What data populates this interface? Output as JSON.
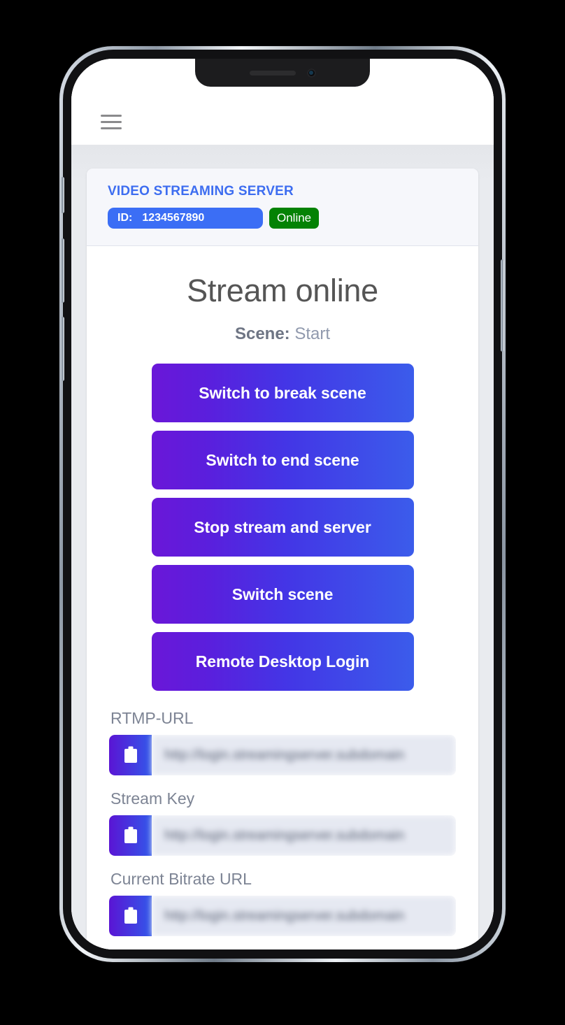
{
  "device": {
    "type": "smartphone-mockup",
    "notch": {
      "speaker": "earpiece-speaker",
      "camera": "front-camera"
    },
    "buttons": [
      "mute-switch",
      "volume-up",
      "volume-down",
      "power"
    ]
  },
  "app": {
    "topbar": {
      "menu_icon": "hamburger-menu-icon"
    },
    "card": {
      "server_title": "VIDEO STREAMING SERVER",
      "id_label": "ID:",
      "id_value": "1234567890",
      "status": "Online",
      "status_color": "#048204",
      "id_pill_color": "#3b6ef5",
      "title_color": "#3d6df0"
    },
    "stream": {
      "state": "Stream online",
      "scene_label": "Scene:",
      "scene_value": "Start"
    },
    "actions": [
      {
        "label": "Switch to break scene",
        "name": "switch-to-break-scene-button"
      },
      {
        "label": "Switch to end scene",
        "name": "switch-to-end-scene-button"
      },
      {
        "label": "Stop stream and server",
        "name": "stop-stream-and-server-button"
      },
      {
        "label": "Switch scene",
        "name": "switch-scene-button"
      },
      {
        "label": "Remote Desktop Login",
        "name": "remote-desktop-login-button"
      }
    ],
    "button_gradient": {
      "from": "#6a17d8",
      "to": "#3b5ceb"
    },
    "fields": [
      {
        "label": "RTMP-URL",
        "value": "http://login.streamingserver.subdomain",
        "copy_icon": "clipboard-icon"
      },
      {
        "label": "Stream Key",
        "value": "http://login.streamingserver.subdomain",
        "copy_icon": "clipboard-icon"
      },
      {
        "label": "Current Bitrate URL",
        "value": "http://login.streamingserver.subdomain",
        "copy_icon": "clipboard-icon"
      }
    ]
  }
}
